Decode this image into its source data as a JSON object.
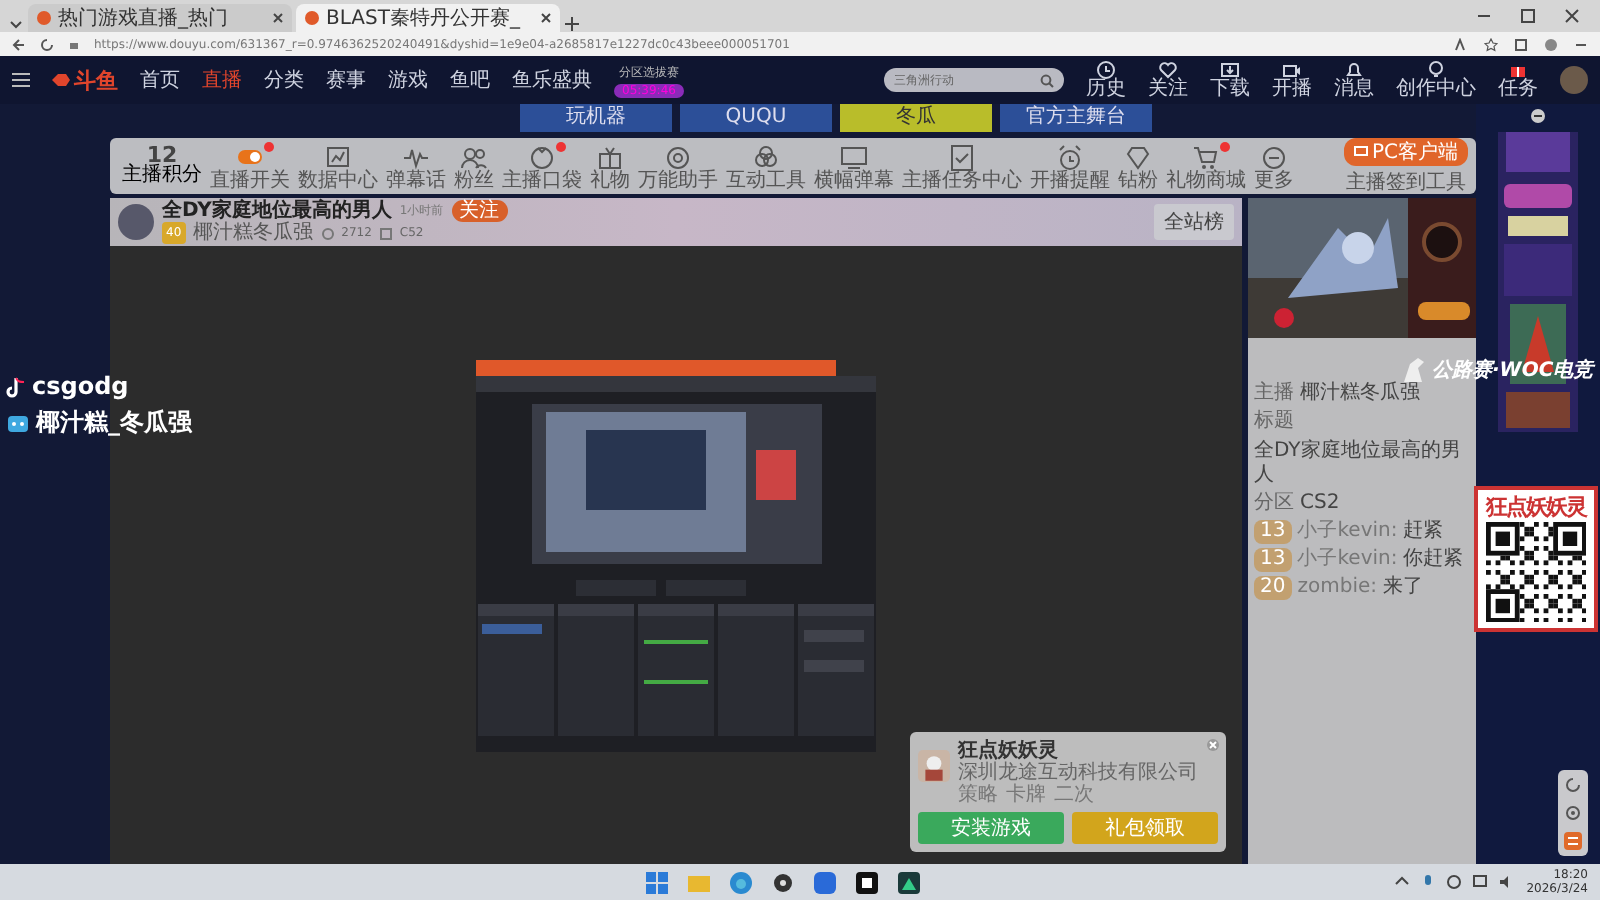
{
  "browser": {
    "tabs": [
      {
        "title": "热门游戏直播_热门",
        "selected": false
      },
      {
        "title": "BLAST秦特丹公开赛_",
        "selected": true
      }
    ],
    "url": "https://www.douyu.com/631367_r=0.9746362520240491&dyshid=1e9e04-a2685817e1227dc0c43beee000051701"
  },
  "site_nav": {
    "logo": "斗鱼",
    "items": [
      {
        "label": "首页",
        "selected": false
      },
      {
        "label": "直播",
        "selected": true
      },
      {
        "label": "分类",
        "selected": false
      },
      {
        "label": "赛事",
        "selected": false
      },
      {
        "label": "游戏",
        "selected": false
      },
      {
        "label": "鱼吧",
        "selected": false
      },
      {
        "label": "鱼乐盛典",
        "selected": false
      }
    ],
    "promo": {
      "title": "分区选拔赛",
      "countdown": "05:39:46"
    },
    "search": {
      "placeholder": "三角洲行动"
    },
    "actions": [
      {
        "kind": "history",
        "label": "历史"
      },
      {
        "kind": "follow",
        "label": "关注"
      },
      {
        "kind": "download",
        "label": "下载"
      },
      {
        "kind": "live",
        "label": "开播"
      },
      {
        "kind": "message",
        "label": "消息"
      },
      {
        "kind": "creator",
        "label": "创作中心"
      },
      {
        "kind": "task",
        "label": "任务"
      }
    ]
  },
  "banner": {
    "buttons": [
      {
        "label": "玩机器",
        "selected": false
      },
      {
        "label": "QUQU",
        "selected": false
      },
      {
        "label": "冬瓜",
        "selected": true
      },
      {
        "label": "官方主舞台",
        "selected": false
      }
    ]
  },
  "toolbar": {
    "score": "12",
    "score_label": "主播积分",
    "items": [
      {
        "kind": "switch",
        "label": "直播开关",
        "badge": true
      },
      {
        "kind": "chart",
        "label": "数据中心",
        "badge": false
      },
      {
        "kind": "wave",
        "label": "弹幕话",
        "badge": false
      },
      {
        "kind": "people",
        "label": "粉丝",
        "badge": false
      },
      {
        "kind": "bag",
        "label": "主播口袋",
        "badge": true
      },
      {
        "kind": "gift",
        "label": "礼物",
        "badge": false
      },
      {
        "kind": "camera",
        "label": "万能助手",
        "badge": false
      },
      {
        "kind": "tools",
        "label": "互动工具",
        "badge": false
      },
      {
        "kind": "screen",
        "label": "横幅弹幕",
        "badge": false
      },
      {
        "kind": "task",
        "label": "主播任务中心",
        "badge": false
      },
      {
        "kind": "clock",
        "label": "开播提醒",
        "badge": false
      },
      {
        "kind": "gem",
        "label": "钻粉",
        "badge": false
      },
      {
        "kind": "cart",
        "label": "礼物商城",
        "badge": true
      },
      {
        "kind": "more",
        "label": "更多",
        "badge": false
      }
    ],
    "client_button": "PC客户端",
    "client_note": "主播签到工具"
  },
  "room": {
    "title": "全DY家庭地位最高的男人",
    "time": "1小时前",
    "follow": "关注",
    "level": "40",
    "owner": "椰汁糕冬瓜强",
    "heat": "2712",
    "fans": "C52",
    "rank": "全站榜"
  },
  "stream_overlay": [
    {
      "kind": "douyin",
      "text": "csgodg"
    },
    {
      "kind": "bilibili",
      "text": "椰汁糕_冬瓜强"
    }
  ],
  "woc_logo": "公路赛·WOC电竞",
  "qr_ad": {
    "title": "狂点妖妖灵"
  },
  "chat": {
    "messages": [
      {
        "kind": "info",
        "label": "主播",
        "text": "椰汁糕冬瓜强"
      },
      {
        "kind": "info",
        "label": "标题",
        "text": "全DY家庭地位最高的男人"
      },
      {
        "kind": "info",
        "label": "分区",
        "text": "CS2"
      },
      {
        "kind": "user",
        "badge": "13",
        "name": "小子kevin:",
        "text": "赶紧"
      },
      {
        "kind": "user",
        "badge": "13",
        "name": "小子kevin:",
        "text": "你赶紧"
      },
      {
        "kind": "user",
        "badge": "20",
        "name": "zombie:",
        "text": "来了"
      }
    ]
  },
  "popup": {
    "title": "狂点妖妖灵",
    "company": "深圳龙途互动科技有限公司",
    "tags": [
      "策略",
      "卡牌",
      "二次"
    ],
    "buttons": [
      {
        "kind": "install",
        "label": "安装游戏"
      },
      {
        "kind": "gift",
        "label": "礼包领取"
      }
    ]
  },
  "taskbar": {
    "time": "18:20",
    "date": "2026/3/24"
  }
}
